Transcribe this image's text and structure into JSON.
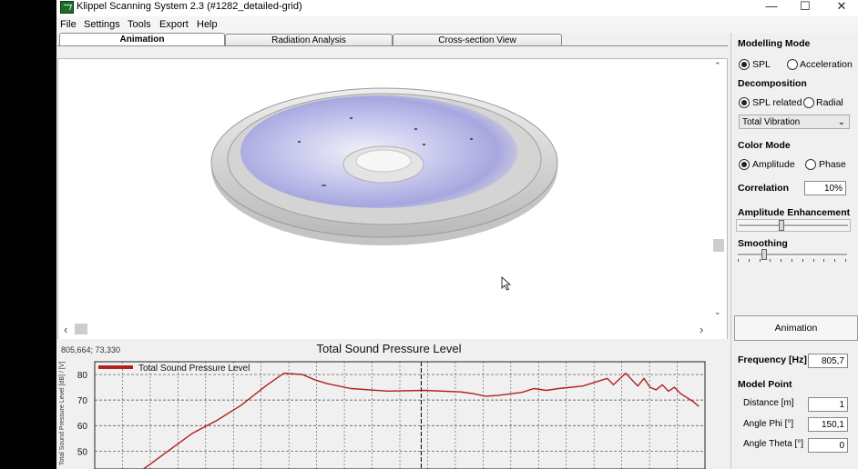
{
  "window": {
    "title": "Klippel Scanning System 2.3 (#1282_detailed-grid)",
    "controls": [
      "—",
      "☐",
      "✕"
    ]
  },
  "menu": [
    "File",
    "Settings",
    "Tools",
    "Export",
    "Help"
  ],
  "tabs": [
    {
      "label": "Animation",
      "active": true
    },
    {
      "label": "Radiation Analysis",
      "active": false
    },
    {
      "label": "Cross-section View",
      "active": false
    }
  ],
  "viewport": {
    "scroll_up": "⌃",
    "scroll_down": "⌄",
    "scroll_left": "‹",
    "scroll_right": "›"
  },
  "chart_header": {
    "coords": "805,664; 73,330",
    "title": "Total Sound Pressure Level"
  },
  "chart_data": {
    "type": "line",
    "title": "Total Sound Pressure Level",
    "ylabel": "Total Sound Pressure Level [dB] / [V]",
    "yticks": [
      "80",
      "70",
      "60",
      "50"
    ],
    "ylim": [
      43,
      85
    ],
    "xlim": [
      0,
      1
    ],
    "grid": true,
    "legend_position": "top-left",
    "series": [
      {
        "name": "Total Sound Pressure Level",
        "color": "#b22020",
        "x": [
          0.08,
          0.12,
          0.16,
          0.2,
          0.24,
          0.28,
          0.31,
          0.34,
          0.36,
          0.38,
          0.42,
          0.48,
          0.54,
          0.6,
          0.62,
          0.64,
          0.66,
          0.7,
          0.72,
          0.74,
          0.76,
          0.8,
          0.84,
          0.85,
          0.87,
          0.89,
          0.9,
          0.91,
          0.92,
          0.93,
          0.94,
          0.95,
          0.96,
          0.97,
          0.98,
          0.99
        ],
        "y": [
          43.0,
          50.0,
          57.0,
          62.0,
          68.0,
          75.5,
          80.5,
          80.0,
          78.0,
          76.5,
          74.5,
          73.5,
          73.8,
          73.2,
          72.5,
          71.5,
          71.8,
          73.0,
          74.5,
          73.8,
          74.5,
          75.5,
          78.5,
          76.0,
          80.5,
          75.5,
          78.5,
          75.0,
          74.0,
          76.0,
          73.5,
          75.0,
          72.5,
          71.0,
          69.5,
          67.5
        ]
      }
    ],
    "marker_x": 0.535
  },
  "side": {
    "modelling_mode": {
      "label": "Modelling Mode",
      "options": [
        {
          "label": "SPL",
          "checked": true
        },
        {
          "label": "Acceleration",
          "checked": false
        }
      ]
    },
    "decomposition": {
      "label": "Decomposition",
      "options": [
        {
          "label": "SPL related",
          "checked": true
        },
        {
          "label": "Radial",
          "checked": false
        }
      ],
      "select_value": "Total Vibration",
      "chevron": "⌄"
    },
    "color_mode": {
      "label": "Color Mode",
      "options": [
        {
          "label": "Amplitude",
          "checked": true
        },
        {
          "label": "Phase",
          "checked": false
        }
      ]
    },
    "correlation": {
      "label": "Correlation",
      "value": "10%"
    },
    "amplitude_enhancement": {
      "label": "Amplitude Enhancement",
      "level": 0.38
    },
    "smoothing": {
      "label": "Smoothing",
      "level": 0.22
    },
    "animation_button": "Animation",
    "frequency": {
      "label": "Frequency [Hz]",
      "value": "805,7"
    },
    "model_point": {
      "label": "Model Point",
      "distance": {
        "label": "Distance [m]",
        "value": "1"
      },
      "phi": {
        "label": "Angle Phi [°]",
        "value": "150,1"
      },
      "theta": {
        "label": "Angle Theta [°]",
        "value": "0"
      }
    }
  }
}
